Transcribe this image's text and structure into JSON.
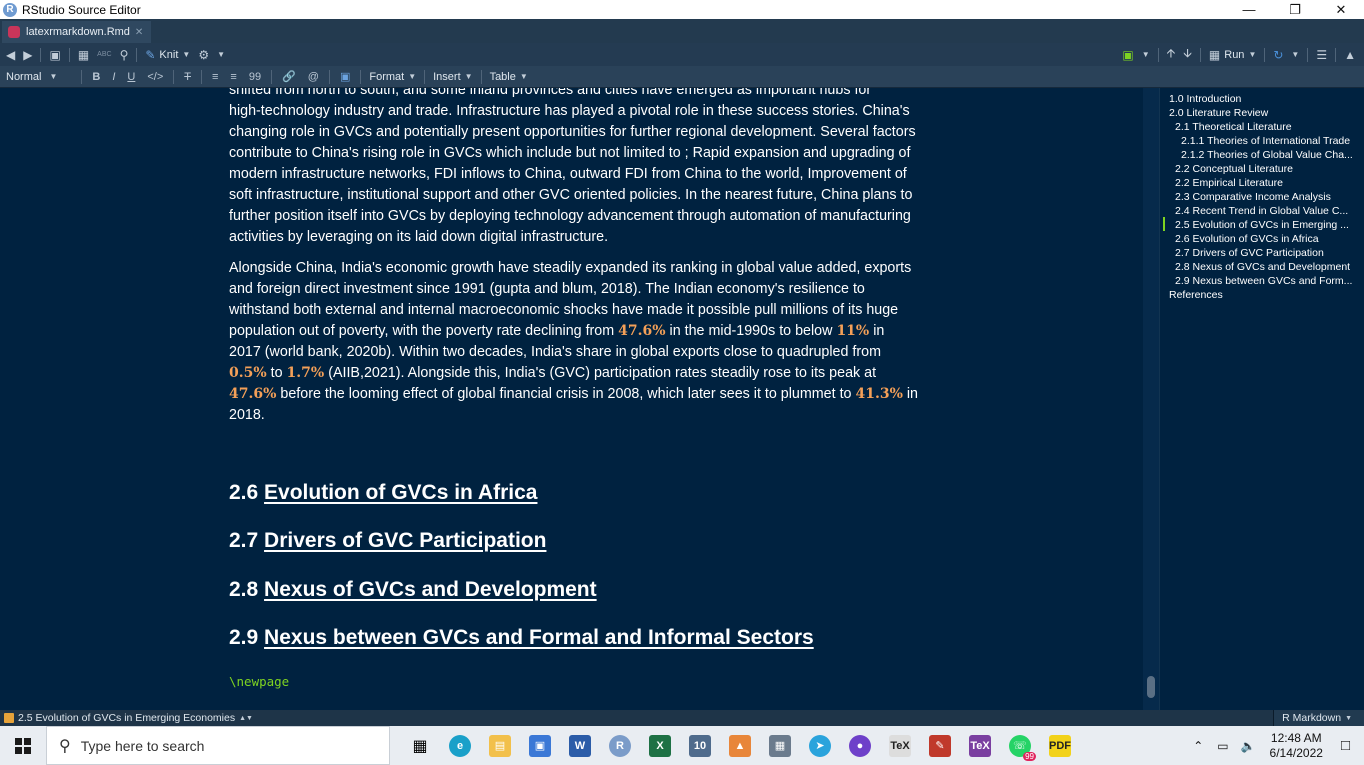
{
  "window": {
    "title": "RStudio Source Editor",
    "app_icon": "R",
    "controls": [
      "minimize-icon",
      "restore-icon",
      "close-icon"
    ]
  },
  "tab": {
    "filename": "latexrmarkdown.Rmd"
  },
  "toolbar": {
    "knit_label": "Knit",
    "run_label": "Run",
    "spell_label": "ABC"
  },
  "visual_toolbar": {
    "style_select": "Normal",
    "bold": "B",
    "italic": "I",
    "underline": "U",
    "code": "</>",
    "clear": "T",
    "quote": "99",
    "at": "@",
    "format_menu": "Format",
    "insert_menu": "Insert",
    "table_menu": "Table"
  },
  "editor": {
    "partial_line": "shifted from north to south, and some inland provinces and cities have emerged as important hubs for",
    "para1": "high-technology industry and trade. Infrastructure has played a pivotal role in these success stories. China's changing role in GVCs and potentially present opportunities for further regional development. Several factors contribute to China's rising role in GVCs which include but not limited to ; Rapid expansion and upgrading of modern infrastructure networks, FDI inflows to China, outward FDI from China to the world, Improvement of soft infrastructure, institutional support and other GVC oriented policies. In the nearest future, China plans to further position itself into GVCs by deploying technology advancement through automation of manufacturing activities by leveraging on its laid down digital infrastructure.",
    "para2": {
      "s1": "Alongside China, India's economic growth have steadily expanded its ranking in global value added, exports and foreign direct investment since 1991 (gupta and blum, 2018). The Indian economy's resilience to withstand both external and internal macroeconomic shocks have made it possible pull millions of its huge population out of poverty, with the poverty rate declining from ",
      "v1": "47.6%",
      "s2": "  in the mid-1990s to below ",
      "v2": "11%",
      "s3": " in 2017 (world bank, 2020b). Within two decades, India's share in global exports close to quadrupled from ",
      "v3": "0.5%",
      "s4": "  to ",
      "v4": "1.7%",
      "s5": "  (AIIB,2021). Alongside this, India's (GVC) participation rates steadily rose to its peak at ",
      "v5": "47.6%",
      "s6": " before the looming effect of global financial crisis in 2008, which later sees it to plummet to ",
      "v6": "41.3%",
      "s7": " in 2018."
    },
    "headings": [
      {
        "num": "2.6",
        "text": "Evolution of GVCs in Africa"
      },
      {
        "num": "2.7",
        "text": "Drivers of GVC Participation"
      },
      {
        "num": "2.8",
        "text": "Nexus of GVCs and Development"
      },
      {
        "num": "2.9",
        "text": "Nexus between GVCs and Formal and Informal Sectors"
      }
    ],
    "code_line": "\\newpage"
  },
  "outline": [
    "1.0 Introduction",
    "2.0 Literature Review",
    "2.1 Theoretical Literature",
    "2.1.1 Theories of International Trade",
    "2.1.2 Theories of Global Value Cha...",
    "2.2 Conceptual Literature",
    "2.2 Empirical Literature",
    "2.3 Comparative Income Analysis",
    "2.4 Recent Trend in Global Value C...",
    "2.5 Evolution of GVCs in Emerging ...",
    "2.6 Evolution of GVCs in Africa",
    "2.7 Drivers of GVC Participation",
    "2.8 Nexus of GVCs and Development",
    "2.9 Nexus between GVCs and Form...",
    "References"
  ],
  "status": {
    "section": "2.5 Evolution of GVCs in Emerging Economies",
    "mode": "R Markdown"
  },
  "taskbar": {
    "search_placeholder": "Type here to search",
    "time": "12:48 AM",
    "date": "6/14/2022",
    "whatsapp_badge": "99"
  },
  "colors": {
    "editor_bg": "#002240",
    "highlight": "#f4a058",
    "code_green": "#7ed321"
  }
}
